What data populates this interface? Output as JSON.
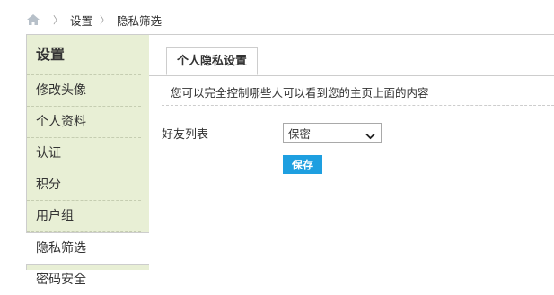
{
  "breadcrumb": {
    "home_icon": "home-icon",
    "items": [
      "设置",
      "隐私筛选"
    ]
  },
  "sidebar": {
    "title": "设置",
    "items": [
      {
        "label": "修改头像"
      },
      {
        "label": "个人资料"
      },
      {
        "label": "认证"
      },
      {
        "label": "积分"
      },
      {
        "label": "用户组"
      },
      {
        "label": "隐私筛选",
        "active": true
      },
      {
        "label": "密码安全"
      }
    ]
  },
  "tabs": [
    {
      "label": "个人隐私设置"
    }
  ],
  "notice": "您可以完全控制哪些人可以看到您的主页上面的内容",
  "form": {
    "friends_label": "好友列表",
    "friends_value": "保密",
    "save_label": "保存"
  },
  "colors": {
    "sidebar_bg": "#e8efd5",
    "accent": "#1e9fe0",
    "border": "#cdcdcd"
  }
}
